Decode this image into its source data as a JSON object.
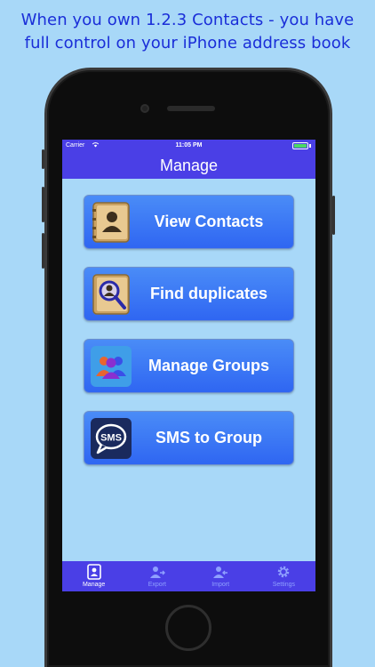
{
  "headline": {
    "line1": "When you own 1.2.3 Contacts - you have",
    "line2": "full control on your iPhone address book"
  },
  "status_bar": {
    "carrier": "Carrier",
    "wifi_icon": "wifi-icon",
    "time": "11:05 PM",
    "battery_icon": "battery-icon"
  },
  "nav": {
    "title": "Manage"
  },
  "buttons": [
    {
      "label": "View Contacts",
      "icon": "address-book-icon"
    },
    {
      "label": "Find duplicates",
      "icon": "search-contact-icon"
    },
    {
      "label": "Manage Groups",
      "icon": "group-people-icon"
    },
    {
      "label": "SMS to Group",
      "icon": "sms-bubble-icon"
    }
  ],
  "tabs": [
    {
      "label": "Manage",
      "icon": "contact-card-icon",
      "active": true
    },
    {
      "label": "Export",
      "icon": "export-user-icon",
      "active": false
    },
    {
      "label": "Import",
      "icon": "import-user-icon",
      "active": false
    },
    {
      "label": "Settings",
      "icon": "gear-icon",
      "active": false
    }
  ],
  "colors": {
    "background": "#a8d8f8",
    "headline": "#1a2ed8",
    "bar": "#4a3fe6",
    "button": "#3a78f5"
  }
}
